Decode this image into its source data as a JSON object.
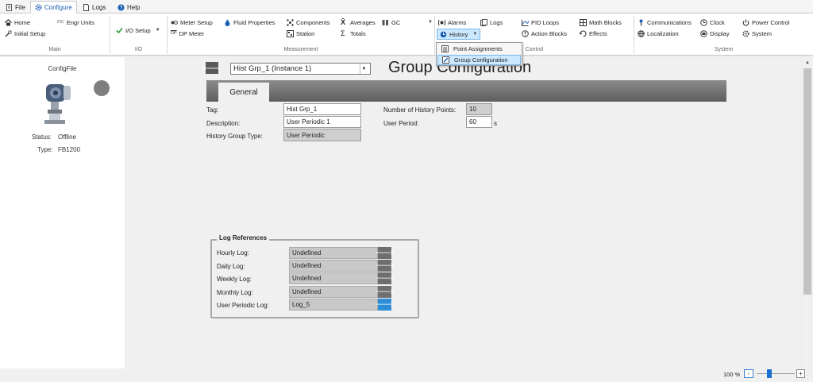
{
  "menu": {
    "tabs": [
      {
        "label": "File",
        "icon": "document-icon"
      },
      {
        "label": "Configure",
        "icon": "gear-icon"
      },
      {
        "label": "Logs",
        "icon": "page-icon"
      },
      {
        "label": "Help",
        "icon": "help-icon"
      }
    ]
  },
  "ribbon": {
    "main": {
      "home": "Home",
      "engr_units": "Engr Units",
      "initial_setup": "Initial Setup",
      "label": "Main",
      "fic": "FIC"
    },
    "io": {
      "io_setup": "I/O Setup",
      "label": "I/O"
    },
    "measurement": {
      "meter_setup": "Meter Setup",
      "dp_meter": "DP Meter",
      "fluid_properties": "Fluid Properties",
      "components": "Components",
      "station": "Station",
      "averages": "Averages",
      "totals": "Totals",
      "gc": "GC",
      "label": "Measurement",
      "dp_glyph": "DP"
    },
    "control": {
      "alarms": "Alarms",
      "history": "History",
      "logs": "Logs",
      "pid_loops": "PID Loops",
      "action_blocks": "Action Blocks",
      "math_blocks": "Math Blocks",
      "effects": "Effects",
      "label": "Control"
    },
    "system": {
      "communications": "Communications",
      "localization": "Localization",
      "clock": "Clock",
      "display": "Display",
      "power_control": "Power Control",
      "system": "System",
      "label": "System"
    }
  },
  "history_menu": {
    "items": [
      {
        "label": "Point Assignments"
      },
      {
        "label": "Group Configuration"
      }
    ]
  },
  "left_panel": {
    "title": "ConfigFile",
    "status_label": "Status:",
    "status_value": "Offline",
    "type_label": "Type:",
    "type_value": "FB1200"
  },
  "header": {
    "instance": "Hist Grp_1 (Instance 1)",
    "title": "Group Configuration"
  },
  "tabs": {
    "general": "General"
  },
  "form": {
    "tag_label": "Tag:",
    "tag_value": "Hist Grp_1",
    "description_label": "Description:",
    "description_value": "User Periodic 1",
    "group_type_label": "History Group Type:",
    "group_type_value": "User Periodic",
    "num_points_label": "Number of History Points:",
    "num_points_value": "10",
    "user_period_label": "User Period:",
    "user_period_value": "60",
    "user_period_unit": "s"
  },
  "log_references": {
    "title": "Log References",
    "rows": [
      {
        "label": "Hourly Log:",
        "value": "Undefined"
      },
      {
        "label": "Daily Log:",
        "value": "Undefined"
      },
      {
        "label": "Weekly Log:",
        "value": "Undefined"
      },
      {
        "label": "Monthly Log:",
        "value": "Undefined"
      },
      {
        "label": "User Periodic Log:",
        "value": "Log_5"
      }
    ]
  },
  "status": {
    "zoom": "100 %",
    "zoom_level": 0.3,
    "zoom_out": "-",
    "zoom_in": "+"
  },
  "colors": {
    "accent": "#1a5fb4",
    "highlight": "#cce8ff",
    "tabbar": "#6e6e6e",
    "active_arrow": "#2b8ed6"
  }
}
